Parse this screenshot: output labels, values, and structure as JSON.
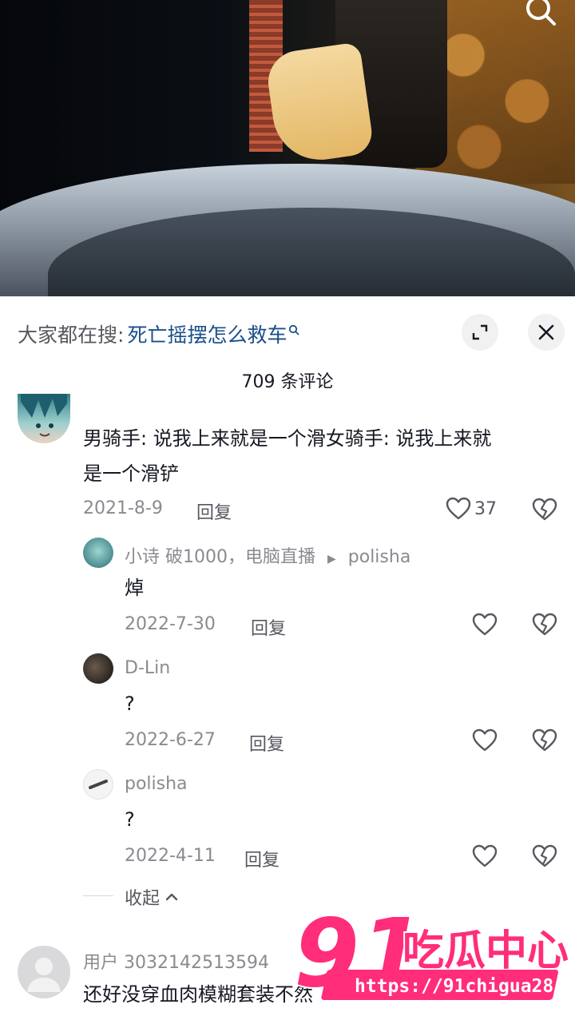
{
  "hot_search": {
    "lead": "大家都在搜:",
    "keyword": "死亡摇摆怎么救车"
  },
  "comment_count": "709 条评论",
  "comments": [
    {
      "text_line1": "男骑手: 说我上来就是一个滑女骑手: 说我上来就",
      "text_line2": "是一个滑铲",
      "date": "2021-8-9",
      "reply_label": "回复",
      "likes": "37",
      "replies": [
        {
          "name": "小诗  破1000，电脑直播",
          "reply_to": "polisha",
          "text": "焯",
          "date": "2022-7-30",
          "reply_label": "回复"
        },
        {
          "name": "D-Lin",
          "text": "?",
          "date": "2022-6-27",
          "reply_label": "回复"
        },
        {
          "name": "polisha",
          "text": "?",
          "date": "2022-4-11",
          "reply_label": "回复"
        }
      ],
      "collapse_label": "收起"
    },
    {
      "name": "用户 3032142513594",
      "text": "还好没穿血肉模糊套装不然 "
    }
  ],
  "watermark": {
    "logo_number": "91",
    "logo_text": "吃瓜中心",
    "url": "https://91chigua28.com"
  },
  "colors": {
    "keyword": "#1a4f8a",
    "muted": "#8a8b91",
    "watermark_pink": "#ff2d7a"
  }
}
